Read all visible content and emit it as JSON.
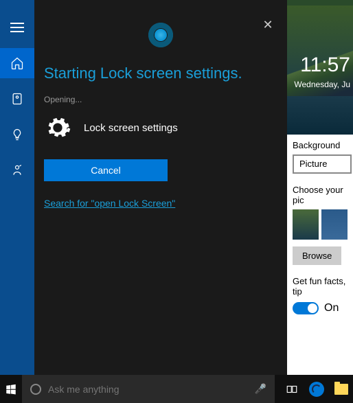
{
  "cortana": {
    "heading": "Starting Lock screen settings.",
    "opening": "Opening...",
    "item_label": "Lock screen settings",
    "cancel": "Cancel",
    "search_link": "Search for \"open Lock Screen\""
  },
  "settings": {
    "clock": "11:57",
    "date": "Wednesday, Ju",
    "background_label": "Background",
    "background_value": "Picture",
    "choose_label": "Choose your pic",
    "browse": "Browse",
    "fun_label": "Get fun facts, tip",
    "toggle_state": "On"
  },
  "taskbar": {
    "search_placeholder": "Ask me anything"
  }
}
